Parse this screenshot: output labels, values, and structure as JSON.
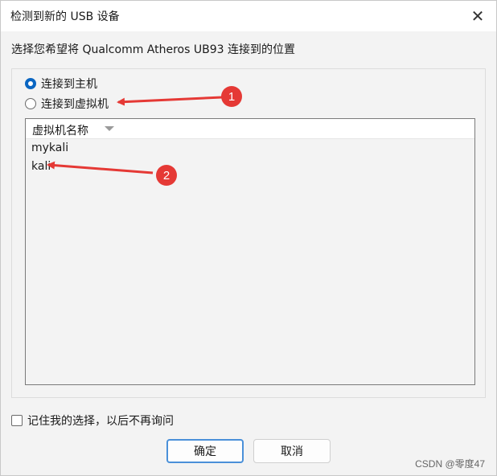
{
  "window": {
    "title": "检测到新的 USB 设备",
    "close_glyph": "✕"
  },
  "prompt": "选择您希望将 Qualcomm Atheros UB93 连接到的位置",
  "options": {
    "host_label": "连接到主机",
    "vm_label": "连接到虚拟机",
    "selected": "host"
  },
  "vm_list": {
    "column_header": "虚拟机名称",
    "items": [
      "mykali",
      "kali"
    ]
  },
  "remember": {
    "label": "记住我的选择，以后不再询问",
    "checked": false
  },
  "buttons": {
    "ok": "确定",
    "cancel": "取消"
  },
  "annotations": {
    "marker_1": "1",
    "marker_2": "2",
    "color": "#e53935"
  },
  "watermark": "CSDN @零度47",
  "colors": {
    "accent": "#0a66c2",
    "annotation": "#e53935"
  }
}
